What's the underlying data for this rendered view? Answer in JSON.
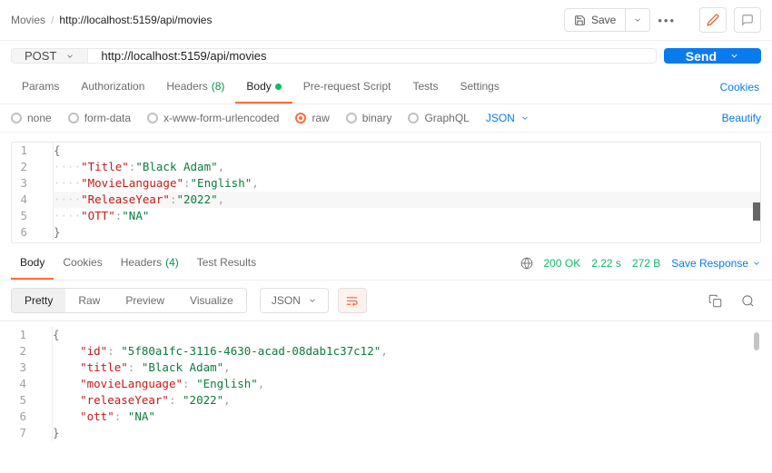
{
  "breadcrumb": {
    "root": "Movies",
    "path": "http://localhost:5159/api/movies"
  },
  "topbar": {
    "save": "Save"
  },
  "request": {
    "method": "POST",
    "url": "http://localhost:5159/api/movies",
    "send": "Send"
  },
  "reqTabs": {
    "params": "Params",
    "authorization": "Authorization",
    "headers": "Headers",
    "headers_count": "(8)",
    "body": "Body",
    "prerequest": "Pre-request Script",
    "tests": "Tests",
    "settings": "Settings",
    "cookies": "Cookies"
  },
  "bodyTypes": {
    "none": "none",
    "formdata": "form-data",
    "xwww": "x-www-form-urlencoded",
    "raw": "raw",
    "binary": "binary",
    "graphql": "GraphQL",
    "format": "JSON",
    "beautify": "Beautify"
  },
  "requestBody": {
    "title_k": "\"Title\"",
    "title_v": "\"Black Adam\"",
    "lang_k": "\"MovieLanguage\"",
    "lang_v": "\"English\"",
    "year_k": "\"ReleaseYear\"",
    "year_v": "\"2022\"",
    "ott_k": "\"OTT\"",
    "ott_v": "\"NA\""
  },
  "respTabs": {
    "body": "Body",
    "cookies": "Cookies",
    "headers": "Headers",
    "headers_count": "(4)",
    "testResults": "Test Results"
  },
  "status": {
    "code": "200 OK",
    "time": "2.22 s",
    "size": "272 B",
    "save": "Save Response"
  },
  "viewModes": {
    "pretty": "Pretty",
    "raw": "Raw",
    "preview": "Preview",
    "visualize": "Visualize",
    "format": "JSON"
  },
  "responseBody": {
    "id_k": "\"id\"",
    "id_v": "\"5f80a1fc-3116-4630-acad-08dab1c37c12\"",
    "title_k": "\"title\"",
    "title_v": "\"Black Adam\"",
    "lang_k": "\"movieLanguage\"",
    "lang_v": "\"English\"",
    "year_k": "\"releaseYear\"",
    "year_v": "\"2022\"",
    "ott_k": "\"ott\"",
    "ott_v": "\"NA\""
  }
}
